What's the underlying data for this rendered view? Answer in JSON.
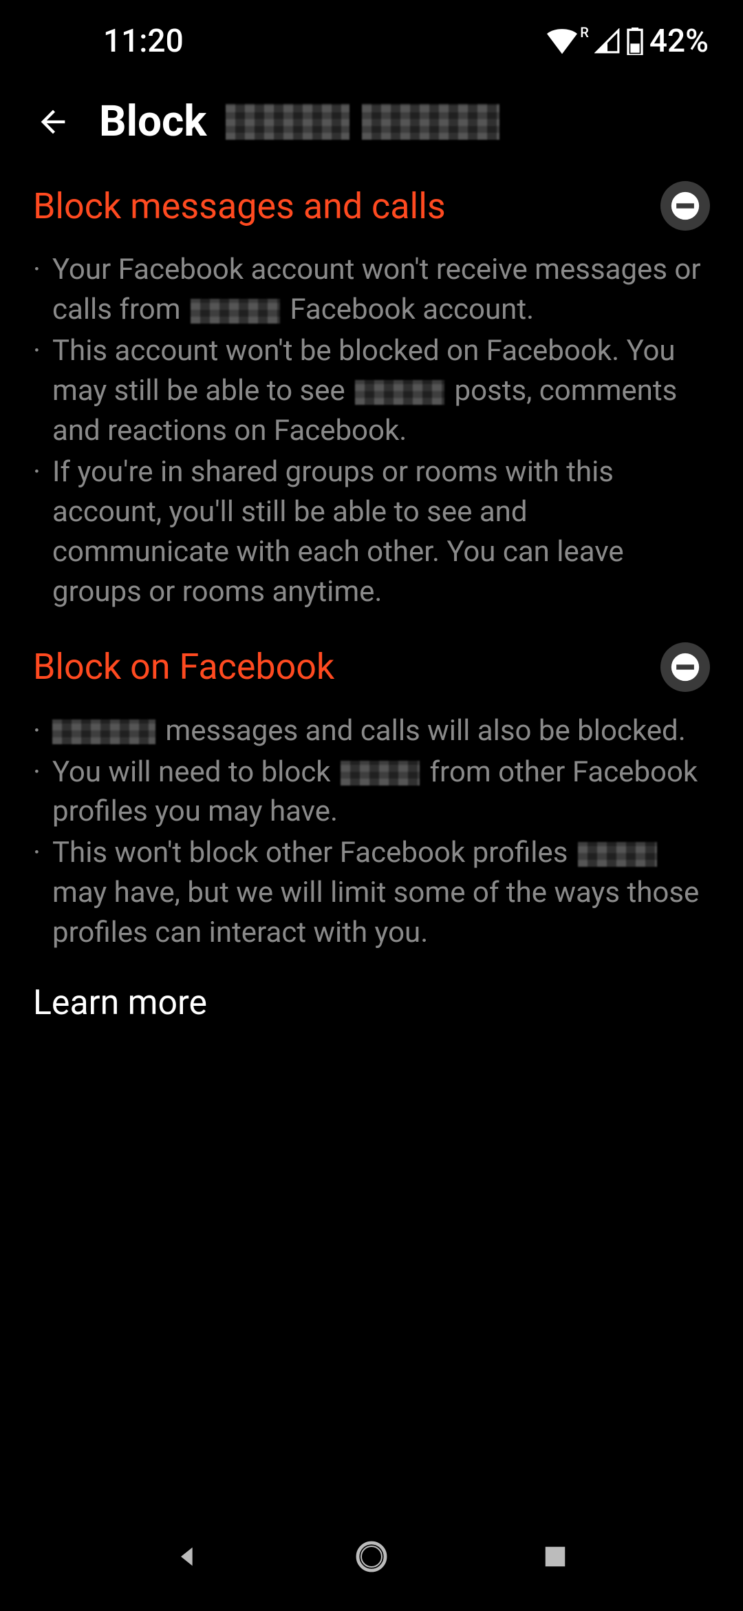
{
  "status": {
    "time": "11:20",
    "battery": "42%",
    "roaming": "R"
  },
  "header": {
    "title_prefix": "Block"
  },
  "sections": [
    {
      "title": "Block messages and calls",
      "bullets": [
        {
          "pre": "Your Facebook account won't receive messages or calls from ",
          "mid_redact": true,
          "post": " Facebook account."
        },
        {
          "pre": "This account won't be blocked on Facebook. You may still be able to see ",
          "mid_redact": true,
          "post": " posts, comments and reactions on Facebook."
        },
        {
          "pre": "If you're in shared groups or rooms with this account, you'll still be able to see and communicate with each other. You can leave groups or rooms anytime.",
          "mid_redact": false,
          "post": ""
        }
      ]
    },
    {
      "title": "Block on Facebook",
      "bullets": [
        {
          "pre": "",
          "mid_redact": true,
          "post": " messages and calls will also be blocked."
        },
        {
          "pre": "You will need to block ",
          "mid_redact": true,
          "post": " from other Facebook profiles you may have."
        },
        {
          "pre": "This won't block other Facebook profiles ",
          "mid_redact": true,
          "post": " may have, but we will limit some of the ways those profiles can interact with you."
        }
      ]
    }
  ],
  "learn_more": "Learn more"
}
